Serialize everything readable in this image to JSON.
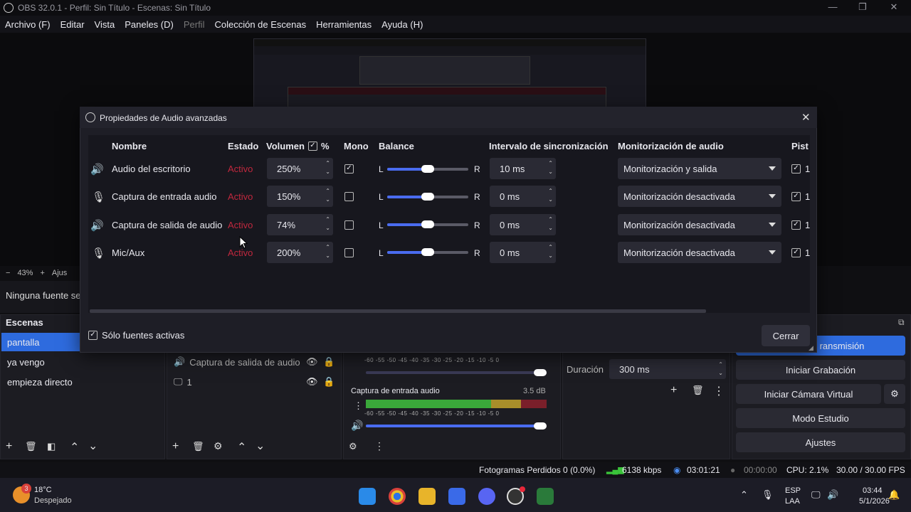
{
  "window": {
    "title": "OBS 32.0.1 - Perfil: Sin Título - Escenas: Sin Título"
  },
  "menu": [
    "Archivo (F)",
    "Editar",
    "Vista",
    "Paneles (D)",
    "Perfil",
    "Colección de Escenas",
    "Herramientas",
    "Ayuda (H)"
  ],
  "preview": {
    "zoom": "43%",
    "adjust_label": "Ajus",
    "no_source": "Ninguna fuente se"
  },
  "scenes": {
    "title": "Escenas",
    "items": [
      "pantalla",
      "ya vengo",
      "empieza directo"
    ],
    "active": 0
  },
  "sources": {
    "items": [
      "Captura de salida de audio",
      "1"
    ]
  },
  "mixer": {
    "scale": "-60 -55 -50 -45 -40 -35 -30 -25 -20 -15 -10 -5 0",
    "channel_name": "Captura de entrada audio",
    "channel_db": "3.5 dB"
  },
  "transition": {
    "duration_label": "Duración",
    "duration_value": "300 ms"
  },
  "controls": {
    "stream": "Iniciar Transmisión",
    "stream_visible": "ransmisión",
    "record": "Iniciar Grabación",
    "virtualcam": "Iniciar Cámara Virtual",
    "studio": "Modo Estudio",
    "settings": "Ajustes"
  },
  "status": {
    "dropped": "Fotogramas Perdidos 0 (0.0%)",
    "bitrate": "6138 kbps",
    "stream_time": "03:01:21",
    "rec_time": "00:00:00",
    "cpu": "CPU: 2.1%",
    "fps": "30.00 / 30.00 FPS"
  },
  "dialog": {
    "title": "Propiedades de Audio avanzadas",
    "headers": {
      "name": "Nombre",
      "state": "Estado",
      "volume": "Volumen",
      "percent": "%",
      "mono": "Mono",
      "balance": "Balance",
      "sync": "Intervalo de sincronización",
      "monitor": "Monitorización de audio",
      "tracks": "Pist"
    },
    "rows": [
      {
        "name": "Audio del escritorio",
        "state": "Activo",
        "volume": "250%",
        "mono": true,
        "balance_l": "L",
        "balance_r": "R",
        "balance": 0.5,
        "sync": "10 ms",
        "monitor": "Monitorización y salida",
        "track": "1"
      },
      {
        "name": "Captura de entrada audio",
        "state": "Activo",
        "volume": "150%",
        "mono": false,
        "balance_l": "L",
        "balance_r": "R",
        "balance": 0.5,
        "sync": "0 ms",
        "monitor": "Monitorización desactivada",
        "track": "1"
      },
      {
        "name": "Captura de salida de audio",
        "state": "Activo",
        "volume": "74%",
        "mono": false,
        "balance_l": "L",
        "balance_r": "R",
        "balance": 0.5,
        "sync": "0 ms",
        "monitor": "Monitorización desactivada",
        "track": "1"
      },
      {
        "name": "Mic/Aux",
        "state": "Activo",
        "volume": "200%",
        "mono": false,
        "balance_l": "L",
        "balance_r": "R",
        "balance": 0.5,
        "sync": "0 ms",
        "monitor": "Monitorización desactivada",
        "track": "1"
      }
    ],
    "active_only": "Sólo fuentes activas",
    "close": "Cerrar"
  },
  "taskbar": {
    "weather_temp": "18°C",
    "weather_text": "Despejado",
    "weather_badge": "3",
    "lang": "ESP",
    "layout": "LAA",
    "time": "03:44",
    "date": "5/1/2026"
  },
  "colors": {
    "accent": "#2e6bde",
    "active_state": "#c0283e"
  }
}
